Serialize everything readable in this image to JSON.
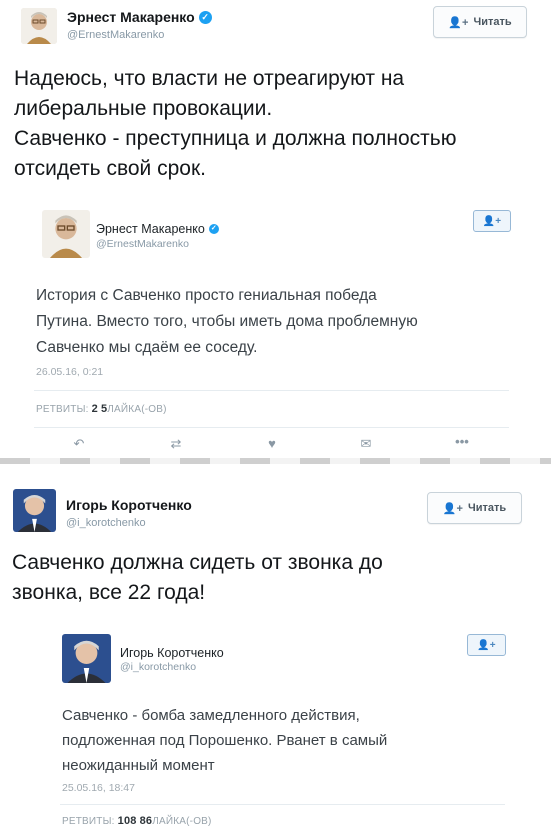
{
  "tweet1": {
    "author_name": "Эрнест Макаренко",
    "author_handle": "@ErnestMakarenko",
    "follow_label": "Читать",
    "text_lines": [
      "Надеюсь, что власти не отреагируют на",
      "либеральные провокации.",
      "Савченко - преступница и должна полностью",
      "отсидеть свой срок."
    ],
    "quoted": {
      "author_name": "Эрнест Макаренко",
      "author_handle": "@ErnestMakarenko",
      "follow_icon": "person-plus-icon",
      "text_lines": [
        "История с Савченко просто гениальная победа",
        "Путина. Вместо того, чтобы иметь дома проблемную",
        "Савченко мы сдаём ее соседу."
      ],
      "date": "26.05.16, 0:21",
      "retweets_label": "РЕТВИТЫ:",
      "retweets_count": "2",
      "likes_count": "5",
      "likes_label": "ЛАЙКА(-ОВ)",
      "actions": [
        "reply-icon",
        "retweet-icon",
        "like-icon",
        "dm-icon",
        "more-icon"
      ]
    }
  },
  "tweet2": {
    "author_name": "Игорь Коротченко",
    "author_handle": "@i_korotchenko",
    "follow_label": "Читать",
    "text_lines": [
      "Савченко должна сидеть от звонка до",
      "звонка, все 22 года!"
    ],
    "quoted": {
      "author_name": "Игорь Коротченко",
      "author_handle": "@i_korotchenko",
      "follow_icon": "person-plus-icon",
      "text_lines": [
        "Савченко - бомба замедленного действия,",
        "подложенная под Порошенко. Рванет в самый",
        "неожиданный момент"
      ],
      "date": "25.05.16, 18:47",
      "retweets_label": "РЕТВИТЫ:",
      "retweets_count": "108",
      "likes_count": "86",
      "likes_label": "ЛАЙКА(-ОВ)"
    }
  },
  "colors": {
    "verified": "#1da1f2",
    "text": "#14171a",
    "muted": "#8899a6"
  }
}
